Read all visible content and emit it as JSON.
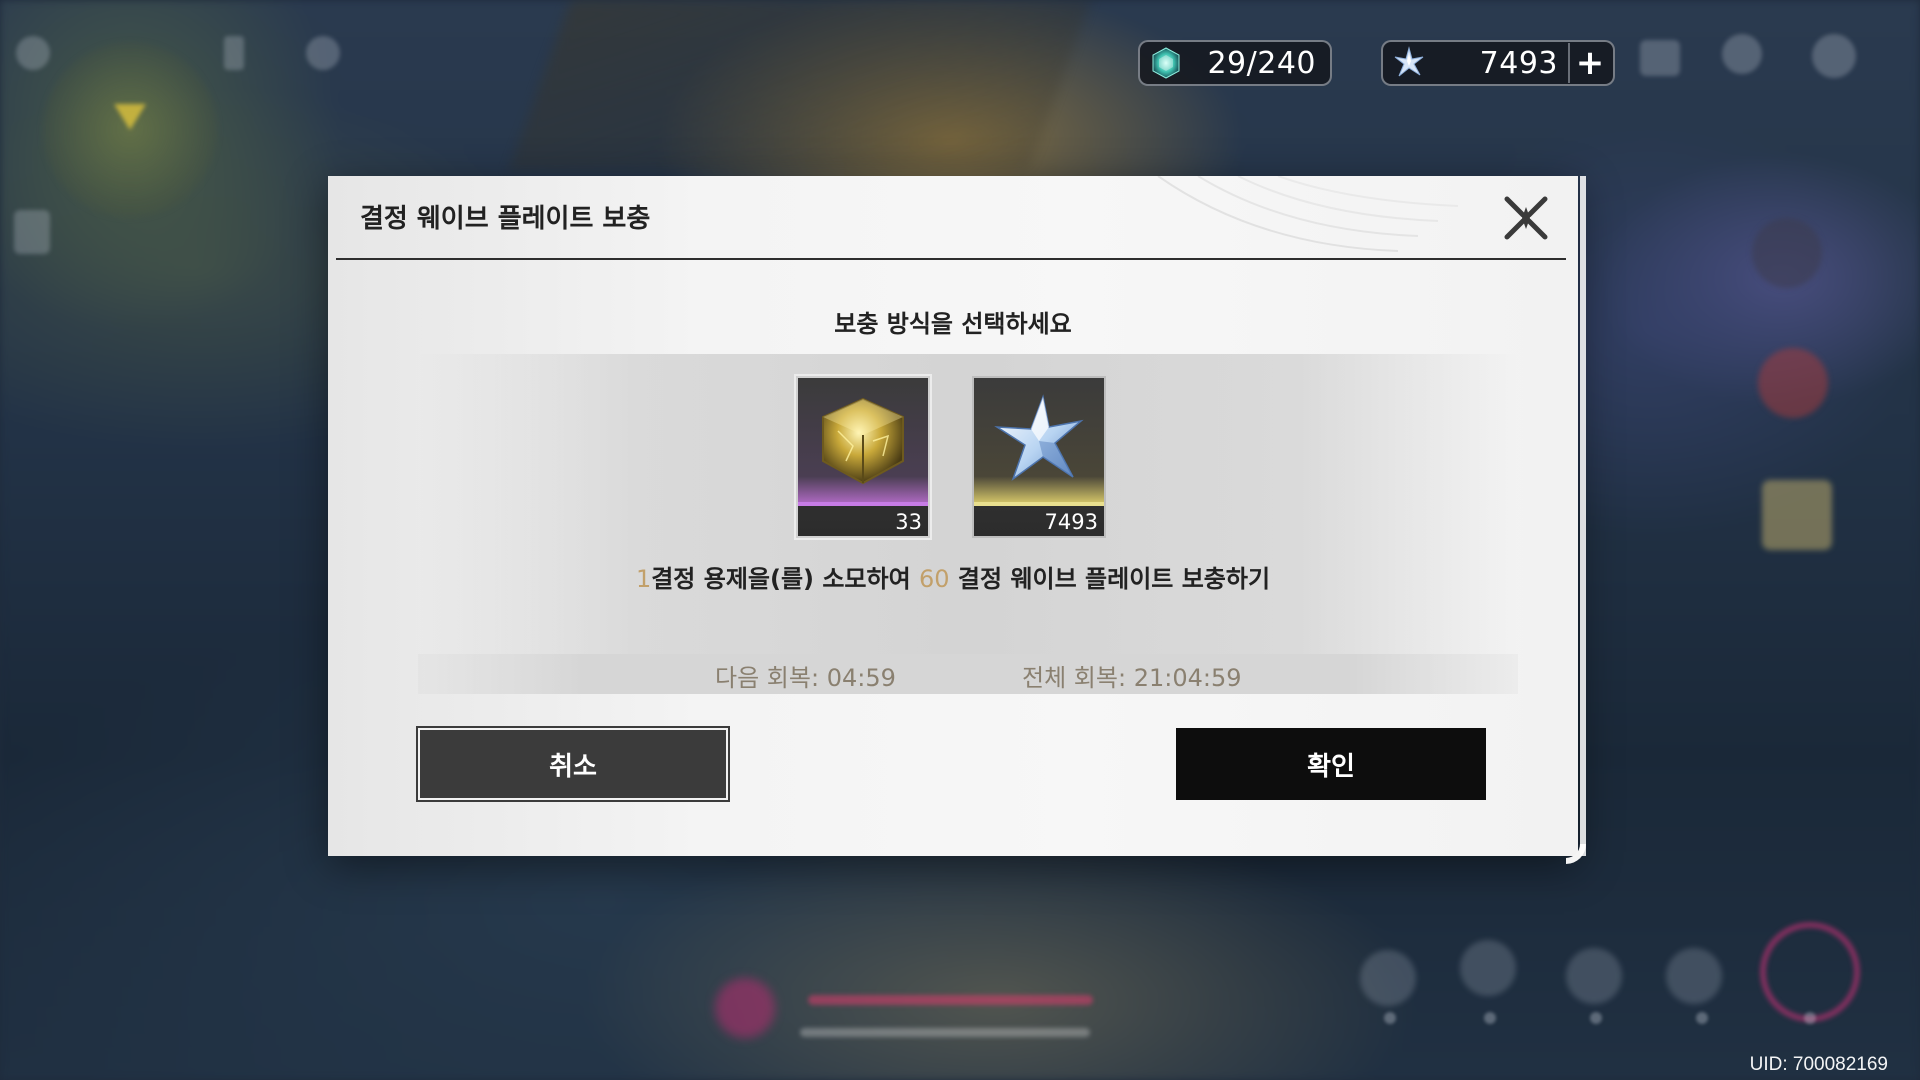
{
  "hud": {
    "stamina": {
      "icon": "crystal-waveplate-icon",
      "value": "29/240"
    },
    "currency": {
      "icon": "astrite-star-icon",
      "value": "7493",
      "plus_label": "+"
    },
    "uid": "UID: 700082169"
  },
  "dialog": {
    "title": "결정 웨이브 플레이트 보충",
    "close_icon": "close-icon",
    "subtitle": "보충 방식을 선택하세요",
    "options": [
      {
        "icon": "crystal-solvent-icon",
        "count": "33",
        "rarity_color": "#c77ce6",
        "selected": true
      },
      {
        "icon": "astrite-icon",
        "count": "7493",
        "rarity_color": "#e9df8e",
        "selected": false
      }
    ],
    "description": {
      "cost": "1",
      "part1": "결정 용제을(를) 소모하여 ",
      "amount": "60",
      "part2": " 결정 웨이브 플레이트 보충하기"
    },
    "timers": {
      "next_label": "다음 회복:",
      "next_value": "04:59",
      "full_label": "전체 회복:",
      "full_value": "21:04:59"
    },
    "buttons": {
      "cancel": "취소",
      "confirm": "확인"
    }
  },
  "colors": {
    "highlight_gold": "#c2a06a",
    "timer_text": "#8a8070",
    "confirm_bg": "#0d0d0d",
    "cancel_bg": "#3b3b3b"
  }
}
